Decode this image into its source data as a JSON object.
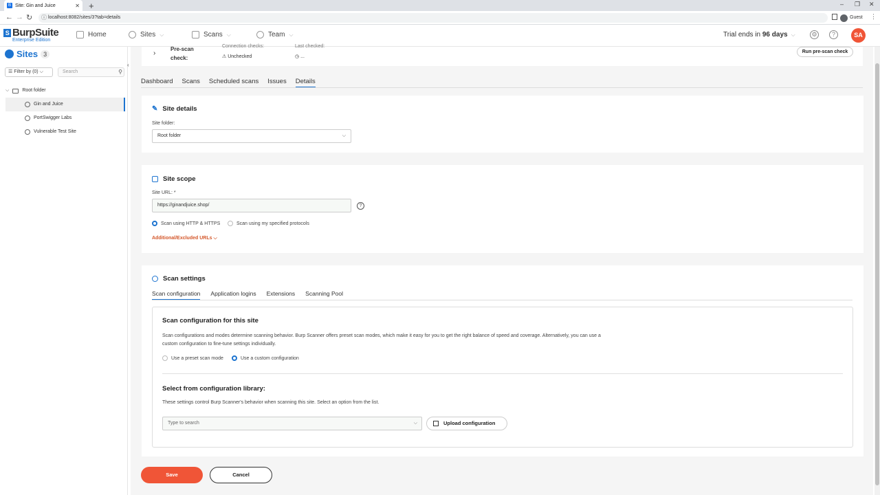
{
  "browser": {
    "tab_title": "Site: Gin and Juice",
    "url": "localhost:8082/sites/3?tab=details",
    "profile_label": "Guest"
  },
  "header": {
    "logo_main": "BurpSuite",
    "logo_sub": "Enterprise Edition",
    "nav": [
      "Home",
      "Sites",
      "Scans",
      "Team"
    ],
    "trial_prefix": "Trial ends in ",
    "trial_days": "96 days",
    "avatar_initials": "SA"
  },
  "sidebar": {
    "title": "Sites",
    "count": "3",
    "filter_label": "Filter by (0)",
    "search_placeholder": "Search",
    "root": "Root folder",
    "items": [
      "Gin and Juice",
      "PortSwigger Labs",
      "Vulnerable Test Site"
    ]
  },
  "precheck": {
    "label": "Pre-scan check:",
    "connection_label": "Connection checks:",
    "connection_value": "Unchecked",
    "last_label": "Last checked:",
    "last_value": "...",
    "run_label": "Run pre-scan check"
  },
  "tabs": [
    "Dashboard",
    "Scans",
    "Scheduled scans",
    "Issues",
    "Details"
  ],
  "site_details": {
    "title": "Site details",
    "folder_label": "Site folder:",
    "folder_value": "Root folder"
  },
  "site_scope": {
    "title": "Site scope",
    "url_label": "Site URL: *",
    "url_value": "https://ginandjuice.shop/",
    "radio_http": "Scan using HTTP & HTTPS",
    "radio_specified": "Scan using my specified protocols",
    "additional": "Additional/Excluded URLs"
  },
  "scan_settings": {
    "title": "Scan settings",
    "subtabs": [
      "Scan configuration",
      "Application logins",
      "Extensions",
      "Scanning Pool"
    ],
    "config_title": "Scan configuration for this site",
    "config_desc_1": "Scan configurations and modes determine scanning behavior. Burp Scanner offers preset scan modes, which make it easy for you to get the right balance of speed and coverage. Alternatively, you can use a",
    "config_desc_2": "custom configuration to fine-tune settings individually.",
    "radio_preset": "Use a preset scan mode",
    "radio_custom": "Use a custom configuration",
    "library_title": "Select from configuration library:",
    "library_desc": "These settings control Burp Scanner's behavior when scanning this site. Select an option from the list.",
    "search_placeholder": "Type to search",
    "upload_label": "Upload configuration"
  },
  "actions": {
    "save": "Save",
    "cancel": "Cancel"
  },
  "colors": {
    "accent": "#1d74d0",
    "brand_orange": "#f05537"
  }
}
